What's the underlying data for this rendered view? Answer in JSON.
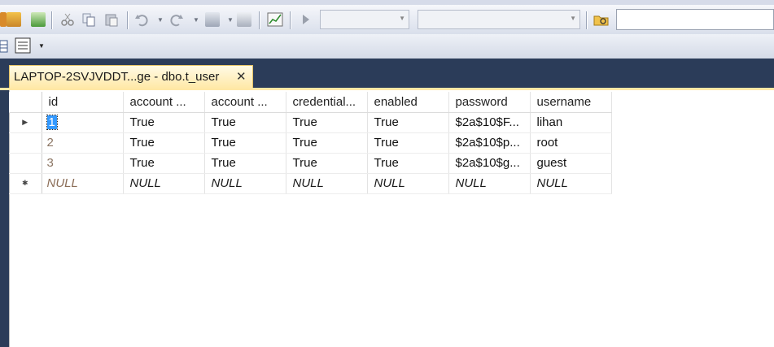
{
  "menu": {
    "text": ""
  },
  "toolbar": {
    "icons": [
      "new-query-icon",
      "database-icon",
      "add-icon",
      "cut-icon",
      "copy-icon",
      "paste-icon",
      "undo-icon",
      "redo-icon",
      "pending-changes-icon",
      "show-pane-icon",
      "chart-icon",
      "execute-icon",
      "folder-icon"
    ],
    "combo1_value": "",
    "combo2_value": "",
    "search_value": ""
  },
  "toolbar2": {
    "icons": [
      "grid-view-icon",
      "properties-icon",
      "dropdown-icon"
    ]
  },
  "document_tab": {
    "title": "LAPTOP-2SVJVDDT...ge - dbo.t_user",
    "close_glyph": "✕"
  },
  "grid": {
    "columns": [
      "id",
      "account ...",
      "account ...",
      "credential...",
      "enabled",
      "password",
      "username"
    ],
    "rows": [
      {
        "indicator": "▶",
        "cells": [
          "1",
          "True",
          "True",
          "True",
          "True",
          "$2a$10$F...",
          "lihan"
        ]
      },
      {
        "indicator": "",
        "cells": [
          "2",
          "True",
          "True",
          "True",
          "True",
          "$2a$10$p...",
          "root"
        ]
      },
      {
        "indicator": "",
        "cells": [
          "3",
          "True",
          "True",
          "True",
          "True",
          "$2a$10$g...",
          "guest"
        ]
      },
      {
        "indicator": "✱",
        "cells": [
          "NULL",
          "NULL",
          "NULL",
          "NULL",
          "NULL",
          "NULL",
          "NULL"
        ]
      }
    ]
  },
  "colors": {
    "workspace": "#2b3c59",
    "tab": "#ffe8a6",
    "selection": "#3399ff"
  }
}
